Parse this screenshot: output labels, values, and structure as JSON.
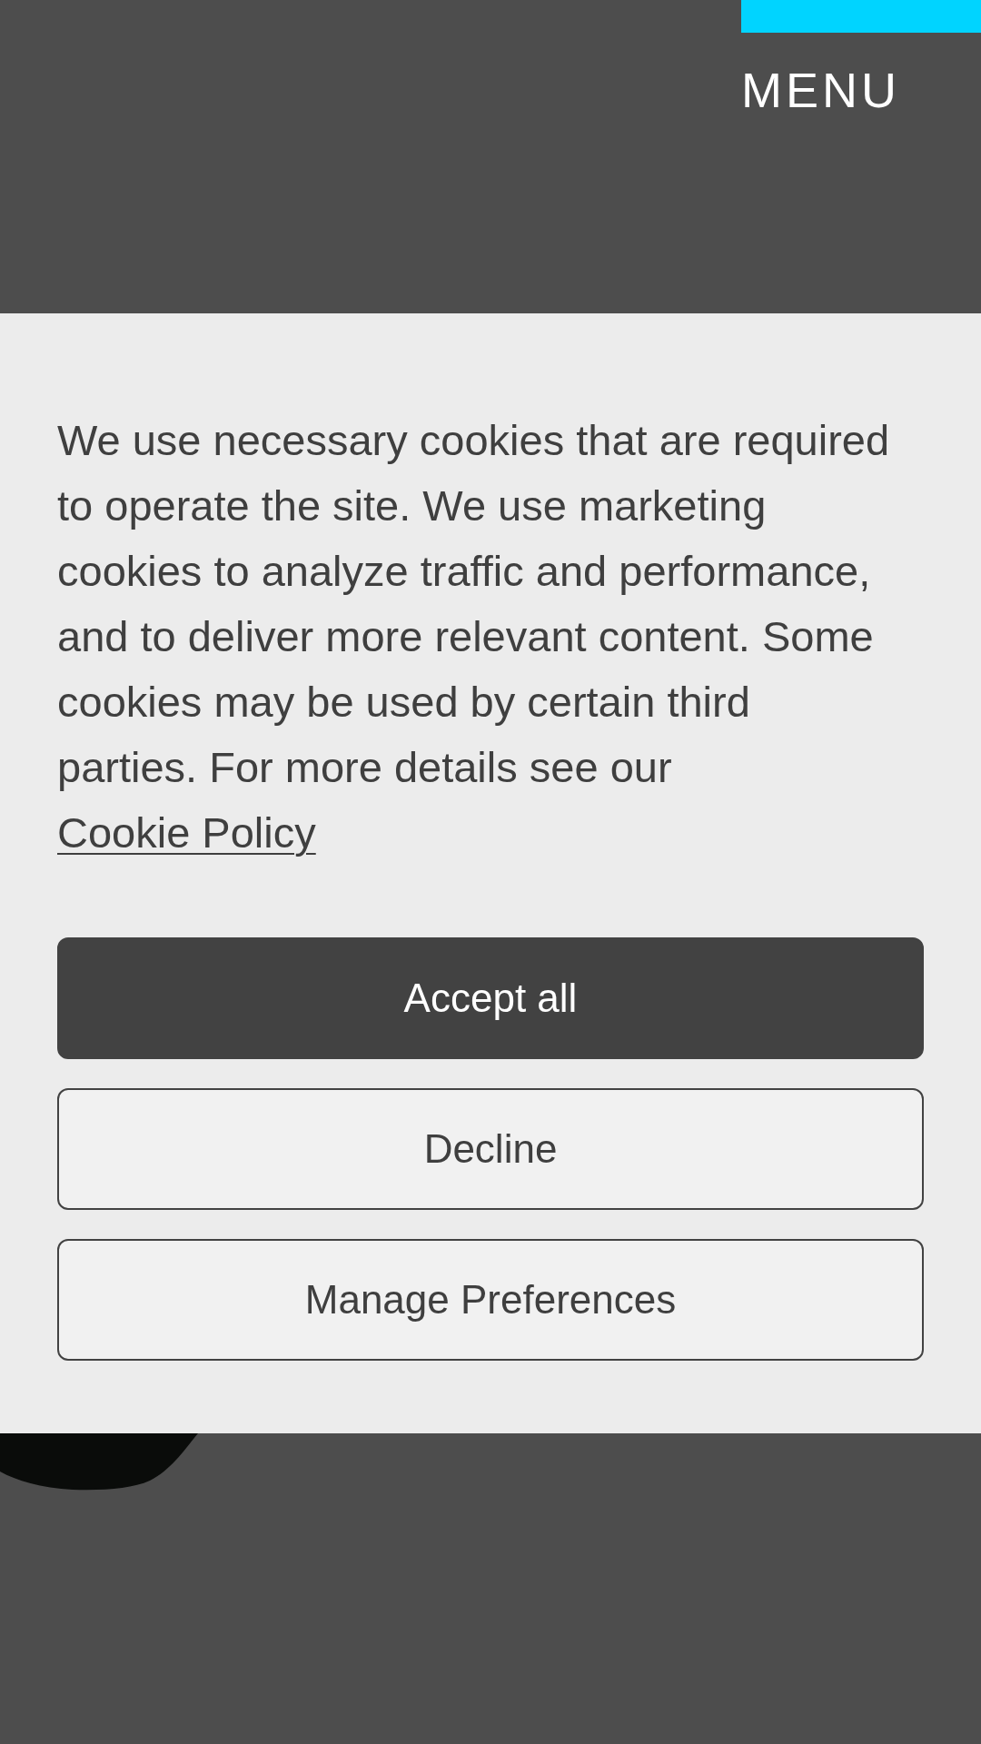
{
  "header": {
    "menu_label": "MENU"
  },
  "cookie_banner": {
    "message": "We use necessary cookies that are required to operate the site. We use marketing cookies to analyze traffic and performance, and to deliver more relevant content. Some cookies may be used by certain third parties. For more details see our ",
    "link": "Cookie Policy",
    "buttons": [
      {
        "label": "Accept all",
        "kind": "primary"
      },
      {
        "label": "Decline",
        "kind": "secondary"
      },
      {
        "label": "Manage Preferences",
        "kind": "secondary"
      }
    ]
  }
}
